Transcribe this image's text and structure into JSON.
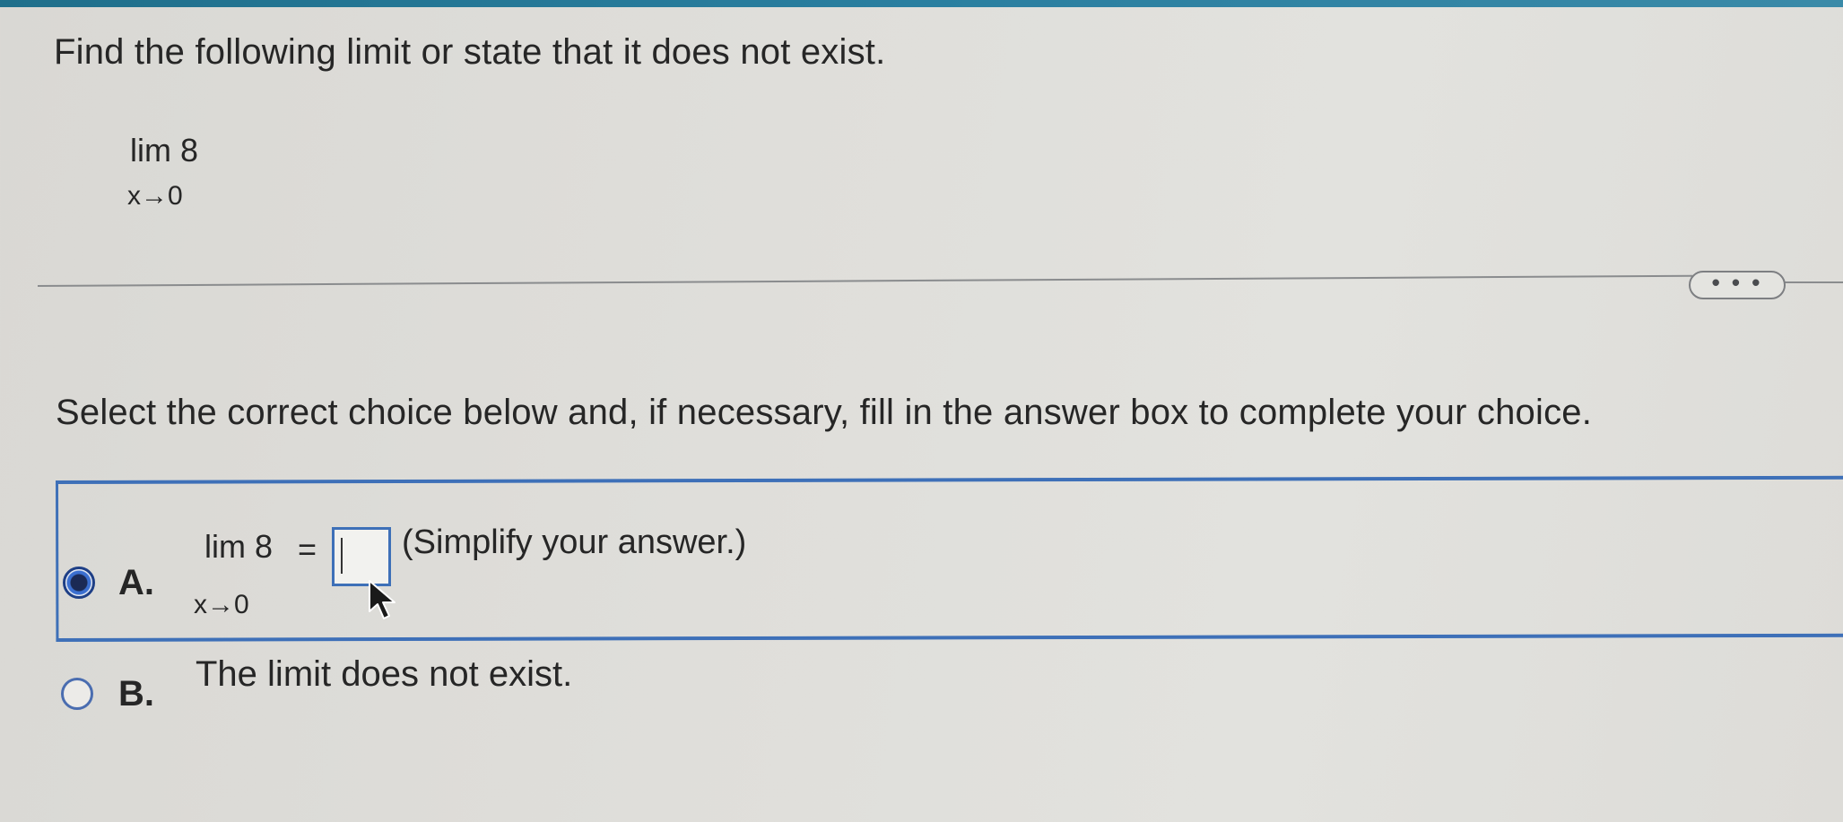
{
  "question": {
    "prompt": "Find the following limit or state that it does not exist.",
    "limit_expr": "lim 8",
    "limit_sub": "x→0"
  },
  "more_button": {
    "label": "• • •"
  },
  "instruction": "Select the correct choice below and, if necessary, fill in the answer box to complete your choice.",
  "choices": [
    {
      "letter": "A.",
      "selected": true,
      "limit_expr": "lim 8",
      "limit_sub": "x→0",
      "equals": "=",
      "answer_value": "",
      "hint": "(Simplify your answer.)"
    },
    {
      "letter": "B.",
      "selected": false,
      "text": "The limit does not exist."
    }
  ],
  "colors": {
    "accent": "#3e70b8",
    "selected_radio": "#1b2a55",
    "top_bar": "#1f6f8b"
  }
}
